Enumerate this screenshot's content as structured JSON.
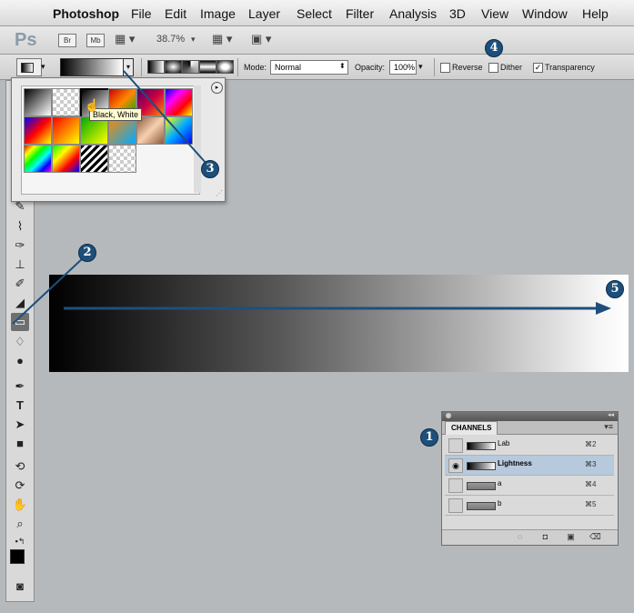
{
  "menubar": {
    "apple": "",
    "items": [
      "Photoshop",
      "File",
      "Edit",
      "Image",
      "Layer",
      "Select",
      "Filter",
      "Analysis",
      "3D",
      "View",
      "Window",
      "Help"
    ]
  },
  "appbar": {
    "logo": "Ps",
    "bridge": "Br",
    "minibridge": "Mb",
    "zoom": "38.7%"
  },
  "options": {
    "mode_label": "Mode:",
    "mode_value": "Normal",
    "opacity_label": "Opacity:",
    "opacity_value": "100%",
    "reverse_label": "Reverse",
    "dither_label": "Dither",
    "transparency_label": "Transparency",
    "transparency_checked": "✓"
  },
  "picker": {
    "tooltip": "Black, White"
  },
  "callouts": {
    "c1": "1",
    "c2": "2",
    "c3": "3",
    "c4": "4",
    "c5": "5"
  },
  "channels": {
    "tab": "CHANNELS",
    "rows": [
      {
        "name": "Lab",
        "shortcut": "⌘2"
      },
      {
        "name": "Lightness",
        "shortcut": "⌘3"
      },
      {
        "name": "a",
        "shortcut": "⌘4"
      },
      {
        "name": "b",
        "shortcut": "⌘5"
      }
    ]
  },
  "colors": {
    "accent": "#1e4f7a",
    "selected_row": "#b7c9dc",
    "canvas_bg": "#b6b9bb"
  }
}
